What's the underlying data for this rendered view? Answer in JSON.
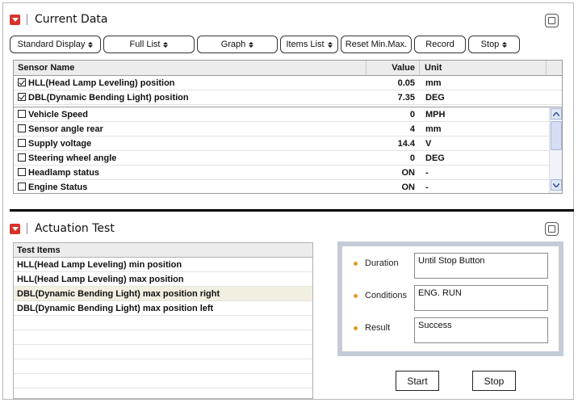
{
  "current_data": {
    "title": "Current Data",
    "toolbar": [
      {
        "label": "Standard Display",
        "dropdown": true,
        "width": 113
      },
      {
        "label": "Full List",
        "dropdown": true,
        "width": 113
      },
      {
        "label": "Graph",
        "dropdown": true,
        "width": 100
      },
      {
        "label": "Items List",
        "dropdown": true,
        "width": 72
      },
      {
        "label": "Reset Min.Max.",
        "dropdown": false,
        "width": 88
      },
      {
        "label": "Record",
        "dropdown": false,
        "width": 64
      },
      {
        "label": "Stop",
        "dropdown": true,
        "width": 64
      }
    ],
    "columns": {
      "name": "Sensor Name",
      "value": "Value",
      "unit": "Unit"
    },
    "fixed_rows": [
      {
        "checked": true,
        "name": "HLL(Head Lamp Leveling) position",
        "value": "0.05",
        "unit": "mm"
      },
      {
        "checked": true,
        "name": "DBL(Dynamic Bending Light) position",
        "value": "7.35",
        "unit": "DEG"
      }
    ],
    "rows": [
      {
        "checked": false,
        "name": "Vehicle Speed",
        "value": "0",
        "unit": "MPH"
      },
      {
        "checked": false,
        "name": "Sensor angle rear",
        "value": "4",
        "unit": "mm"
      },
      {
        "checked": false,
        "name": "Supply voltage",
        "value": "14.4",
        "unit": "V"
      },
      {
        "checked": false,
        "name": "Steering wheel angle",
        "value": "0",
        "unit": "DEG"
      },
      {
        "checked": false,
        "name": "Headlamp status",
        "value": "ON",
        "unit": "-"
      },
      {
        "checked": false,
        "name": "Engine Status",
        "value": "ON",
        "unit": "-"
      }
    ]
  },
  "actuation_test": {
    "title": "Actuation Test",
    "column": "Test Items",
    "items": [
      {
        "label": "HLL(Head Lamp Leveling) min position",
        "selected": false
      },
      {
        "label": "HLL(Head Lamp Leveling) max position",
        "selected": false
      },
      {
        "label": "DBL(Dynamic Bending Light) max position right",
        "selected": true
      },
      {
        "label": "DBL(Dynamic Bending Light) max position left",
        "selected": false
      }
    ],
    "empty_rows": 5,
    "details": {
      "duration_label": "Duration",
      "duration_value": "Until Stop Button",
      "conditions_label": "Conditions",
      "conditions_value": "ENG. RUN",
      "result_label": "Result",
      "result_value": "Success"
    },
    "start_label": "Start",
    "stop_label": "Stop"
  },
  "colors": {
    "accent": "#d8322a",
    "bullet": "#e09a2a",
    "selected_row": "#f2efe0"
  }
}
